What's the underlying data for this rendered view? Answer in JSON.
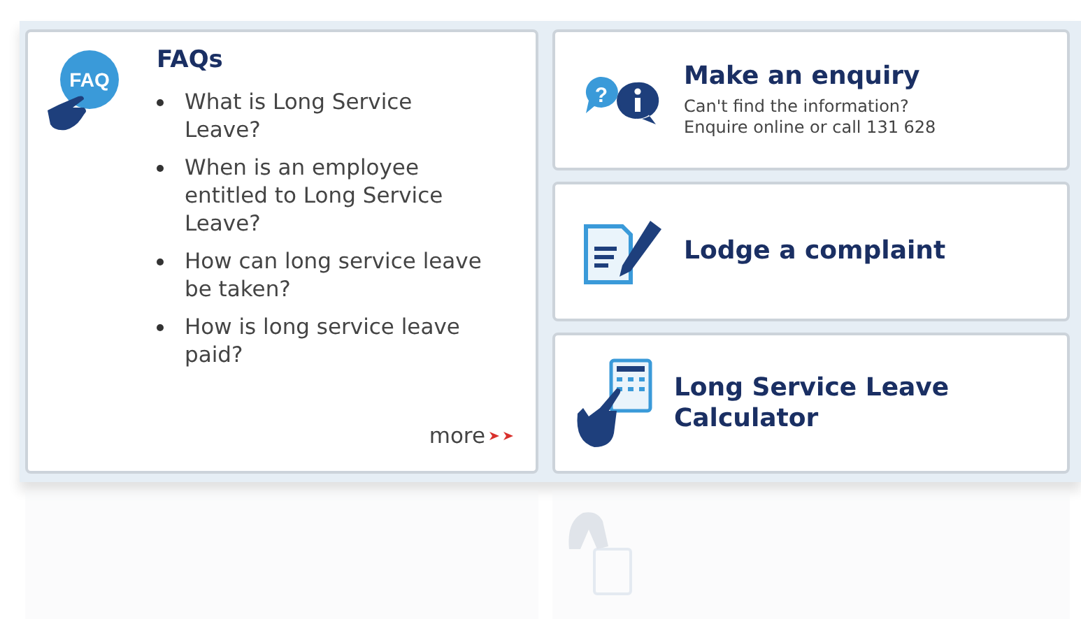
{
  "faq": {
    "title": "FAQs",
    "icon_label": "FAQ",
    "questions": [
      "What is Long Service Leave?",
      "When is an employee entitled to Long Service Leave?",
      "How can long service leave be taken?",
      "How is long service leave paid?"
    ],
    "more": "more"
  },
  "tiles": [
    {
      "kind": "enquiry",
      "icon_label": "?",
      "title": "Make an enquiry",
      "lines": [
        "Can't find the information?",
        "Enquire online or call 131 628"
      ]
    },
    {
      "kind": "complaint",
      "title": "Lodge a complaint"
    },
    {
      "kind": "calculator",
      "title": "Long Service Leave Calculator"
    }
  ]
}
